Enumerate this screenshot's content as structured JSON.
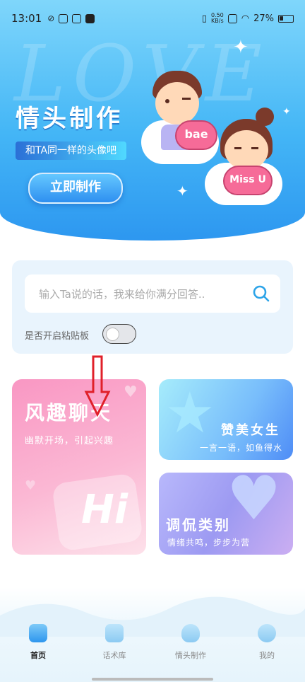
{
  "status_bar": {
    "time": "13:01",
    "net_speed_value": "0.50",
    "net_speed_unit": "KB/s",
    "battery": "27%"
  },
  "banner": {
    "bg_text": "LOVE",
    "title": "情头制作",
    "subtitle": "和TA同一样的头像吧",
    "button": "立即制作",
    "heart_left": "bae",
    "heart_right": "Miss U"
  },
  "input_card": {
    "placeholder": "输入Ta说的话，我来给你满分回答..",
    "paste_label": "是否开启粘贴板"
  },
  "cards": {
    "fun": {
      "title": "风趣聊天",
      "subtitle": "幽默开场，引起兴趣",
      "badge": "Hi"
    },
    "praise": {
      "title": "赞美女生",
      "subtitle": "一言一语，如鱼得水"
    },
    "tease": {
      "title": "调侃类别",
      "subtitle": "情绪共鸣，步步为营"
    }
  },
  "nav": {
    "items": [
      {
        "label": "首页",
        "icon": "home-icon"
      },
      {
        "label": "话术库",
        "icon": "chat-library-icon"
      },
      {
        "label": "情头制作",
        "icon": "heart-avatar-icon"
      },
      {
        "label": "我的",
        "icon": "user-icon"
      }
    ]
  },
  "colors": {
    "banner_top": "#7fd6fb",
    "banner_bottom": "#2d97f0",
    "card_fun": "#f997c3",
    "card_praise": "#78bdfb",
    "card_tease": "#9d9af2",
    "annotation_arrow": "#e0202a"
  }
}
